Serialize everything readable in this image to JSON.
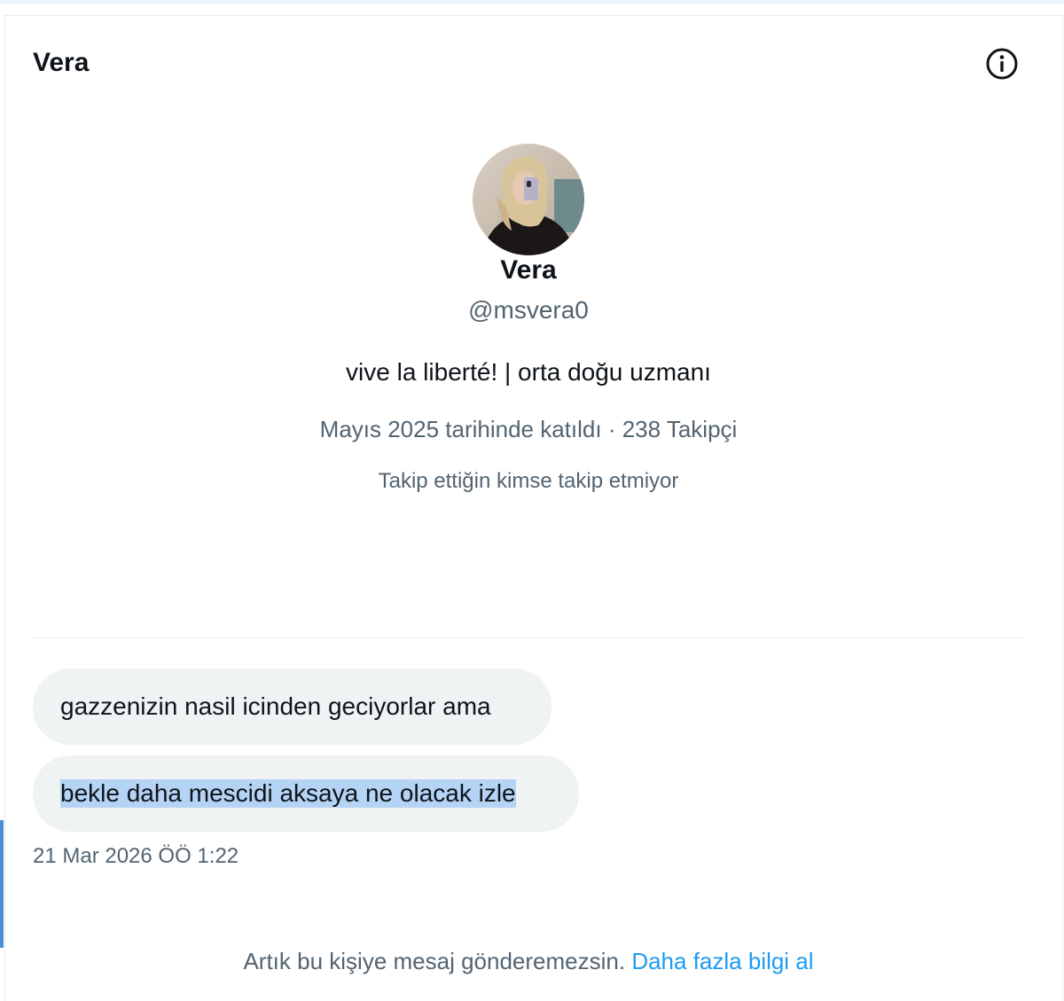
{
  "header": {
    "title": "Vera",
    "info_icon": "info-icon"
  },
  "profile": {
    "name": "Vera",
    "handle": "@msvera0",
    "bio": "vive la liberté! | orta doğu uzmanı",
    "meta": "Mayıs 2025 tarihinde katıldı · 238 Takipçi",
    "mutual": "Takip ettiğin kimse takip etmiyor"
  },
  "messages": [
    {
      "text": "gazzenizin nasil icinden geciyorlar ama"
    },
    {
      "text": "bekle daha mescidi aksaya ne olacak izle"
    }
  ],
  "timestamp": "21 Mar 2026 ÖÖ 1:22",
  "footer": {
    "notice": "Artık bu kişiye mesaj gönderemezsin.",
    "link": "Daha fazla bilgi al"
  },
  "colors": {
    "link": "#1d9bf0",
    "secondary_text": "#536471",
    "bubble_bg": "#eff3f4",
    "selection": "#b5d3f5"
  }
}
